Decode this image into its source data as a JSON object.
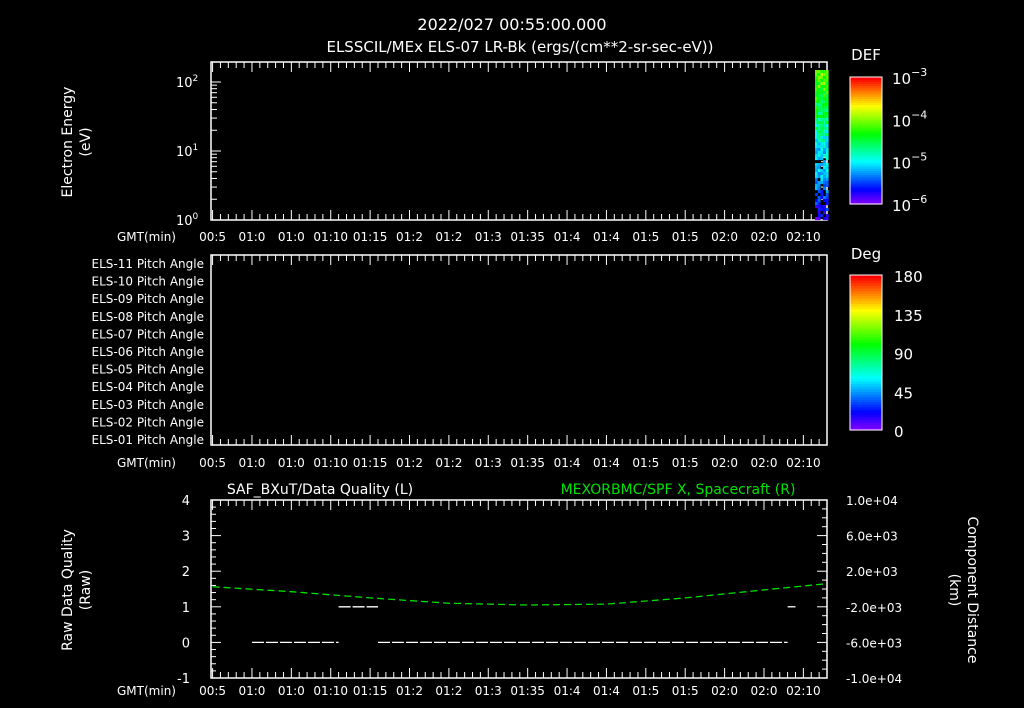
{
  "header": {
    "date_time": "2022/027 00:55:00.000"
  },
  "time_axis": {
    "label": "GMT(min)",
    "start": "00:55",
    "end": "02:13",
    "major_step_min": 5,
    "tick_labels": [
      "00:5",
      "01:0",
      "01:0",
      "01:10",
      "01:15",
      "01:2",
      "01:2",
      "01:3",
      "01:35",
      "01:4",
      "01:4",
      "01:5",
      "01:5",
      "02:0",
      "02:0",
      "02:10"
    ]
  },
  "chart_data": [
    {
      "type": "heatmap",
      "title": "ELSSCIL/MEx ELS-07 LR-Bk  (ergs/(cm**2-sr-sec-eV))",
      "ylabel": "Electron Energy",
      "ylabel_unit": "(eV)",
      "yscale": "log",
      "ylim": [
        1,
        190
      ],
      "y_tick_labels": [
        "10^0",
        "10^1",
        "10^2"
      ],
      "data_time_range": [
        "02:11",
        "02:13"
      ],
      "colorbar": {
        "title": "DEF",
        "scale": "log",
        "range": [
          1e-06,
          0.001
        ],
        "tick_labels": [
          "10^-3",
          "10^-4",
          "10^-5",
          "10^-6"
        ]
      },
      "note_pattern": "high energies green/cyan (~1e-4), low energies blue/violet (~1e-6 to 1e-5)"
    },
    {
      "type": "heatmap",
      "row_labels": [
        "ELS-11 Pitch Angle",
        "ELS-10 Pitch Angle",
        "ELS-09 Pitch Angle",
        "ELS-08 Pitch Angle",
        "ELS-07 Pitch Angle",
        "ELS-06 Pitch Angle",
        "ELS-05 Pitch Angle",
        "ELS-04 Pitch Angle",
        "ELS-03 Pitch Angle",
        "ELS-02 Pitch Angle",
        "ELS-01 Pitch Angle"
      ],
      "colorbar": {
        "title": "Deg",
        "range": [
          0,
          180
        ],
        "tick_labels": [
          "180",
          "135",
          "90",
          "45",
          "0"
        ]
      }
    },
    {
      "type": "line",
      "left_title": "SAF_BXuT/Data Quality (L)",
      "right_title": "MEXORBMC/SPF X, Spacecraft (R)",
      "ylabel_left": "Raw Data Quality",
      "ylabel_left_unit": "(Raw)",
      "ylabel_right": "Component Distance",
      "ylabel_right_unit": "(km)",
      "ylim_left": [
        -1,
        4
      ],
      "y_tick_labels_left": [
        "4",
        "3",
        "2",
        "1",
        "0",
        "-1"
      ],
      "ylim_right": [
        -10000,
        10000
      ],
      "y_tick_labels_right": [
        "1.0e+04",
        "6.0e+03",
        "2.0e+03",
        "-2.0e+03",
        "-6.0e+03",
        "-1.0e+04"
      ],
      "series": [
        {
          "name": "SAF_BXuT/Data Quality (L)",
          "color": "#ffffff",
          "axis": "left",
          "segments": [
            {
              "from": "01:00",
              "to": "01:11",
              "value": 0
            },
            {
              "from": "01:11",
              "to": "01:16",
              "value": 1
            },
            {
              "from": "01:16",
              "to": "02:08",
              "value": 0
            },
            {
              "from": "02:08",
              "to": "02:09",
              "value": 1
            }
          ]
        },
        {
          "name": "MEXORBMC/SPF X, Spacecraft (R)",
          "color": "#00e000",
          "axis": "right",
          "x": [
            "00:55",
            "01:05",
            "01:15",
            "01:25",
            "01:35",
            "01:45",
            "01:55",
            "02:05",
            "02:13"
          ],
          "y": [
            250,
            -300,
            -1000,
            -1600,
            -1800,
            -1700,
            -1000,
            -100,
            600
          ]
        }
      ]
    }
  ]
}
